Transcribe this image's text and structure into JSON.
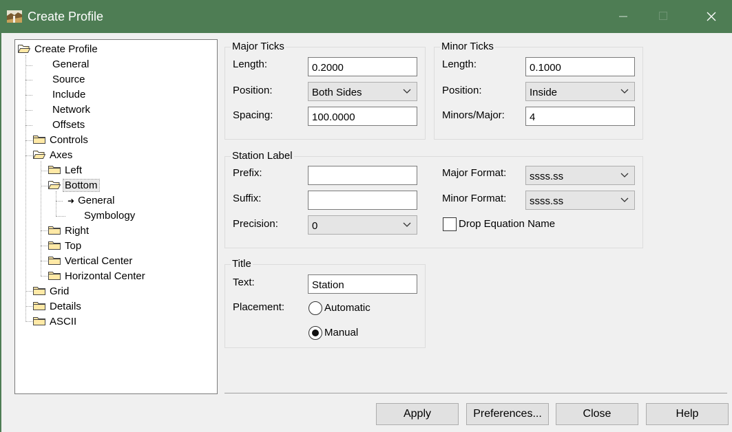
{
  "window": {
    "title": "Create Profile"
  },
  "tree": {
    "root": "Create Profile",
    "items": {
      "general": "General",
      "source": "Source",
      "include": "Include",
      "network": "Network",
      "offsets": "Offsets",
      "controls": "Controls",
      "axes": "Axes",
      "left": "Left",
      "bottom": "Bottom",
      "bottom_general": "General",
      "bottom_symbology": "Symbology",
      "right": "Right",
      "top": "Top",
      "vertical_center": "Vertical Center",
      "horizontal_center": "Horizontal Center",
      "grid": "Grid",
      "details": "Details",
      "ascii": "ASCII"
    },
    "current_marker": "➜"
  },
  "major_ticks": {
    "title": "Major Ticks",
    "length_label": "Length:",
    "length": "0.2000",
    "position_label": "Position:",
    "position": "Both Sides",
    "spacing_label": "Spacing:",
    "spacing": "100.0000"
  },
  "minor_ticks": {
    "title": "Minor Ticks",
    "length_label": "Length:",
    "length": "0.1000",
    "position_label": "Position:",
    "position": "Inside",
    "minors_label": "Minors/Major:",
    "minors": "4"
  },
  "station_label": {
    "title": "Station Label",
    "prefix_label": "Prefix:",
    "prefix": "",
    "suffix_label": "Suffix:",
    "suffix": "",
    "precision_label": "Precision:",
    "precision": "0",
    "major_format_label": "Major Format:",
    "major_format": "ssss.ss",
    "minor_format_label": "Minor Format:",
    "minor_format": "ssss.ss",
    "drop_equation_label": "Drop Equation Name",
    "drop_equation_checked": false
  },
  "title_group": {
    "title": "Title",
    "text_label": "Text:",
    "text": "Station",
    "placement_label": "Placement:",
    "automatic_label": "Automatic",
    "manual_label": "Manual",
    "placement_selected": "Manual"
  },
  "buttons": {
    "apply": "Apply",
    "preferences": "Preferences...",
    "close": "Close",
    "help": "Help"
  },
  "colors": {
    "titlebar": "#4e7d54",
    "dialog_bg": "#f0f0f0"
  }
}
